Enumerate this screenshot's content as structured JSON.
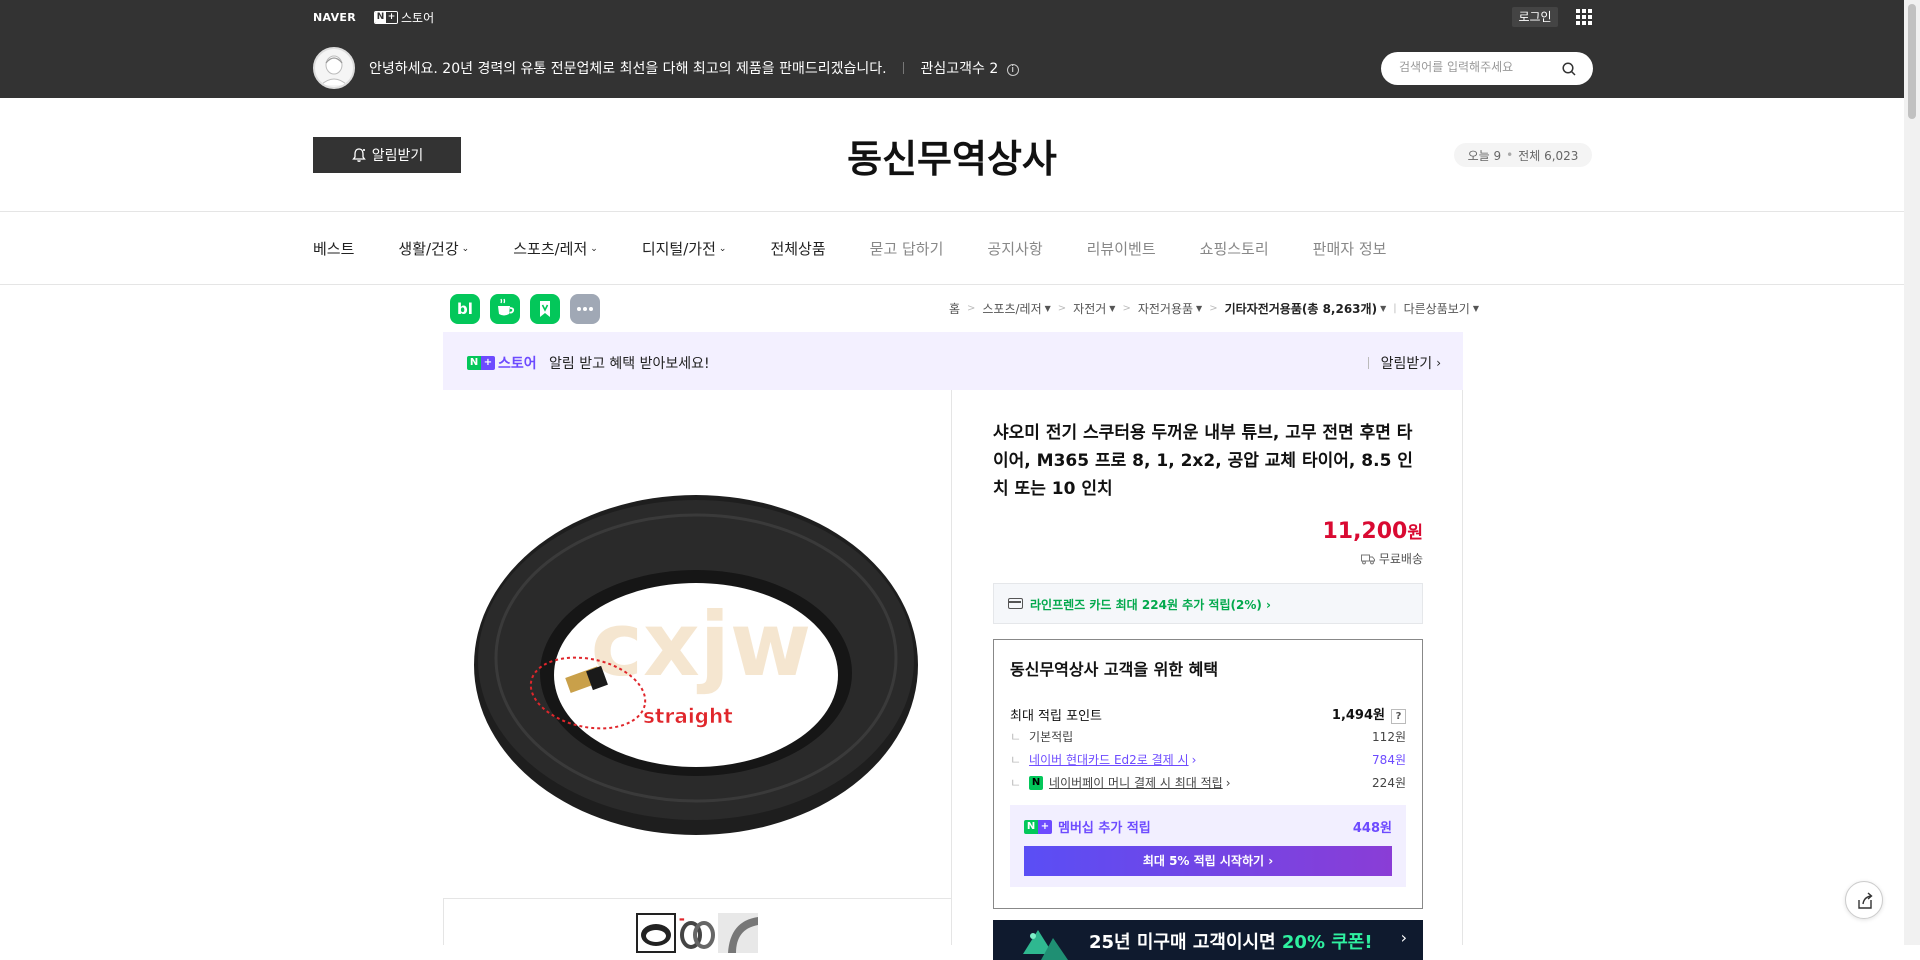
{
  "gnb": {
    "naver_logo": "NAVER",
    "nplus_n": "N",
    "nplus_plus": "+",
    "nplus_label": "스토어",
    "login": "로그인"
  },
  "seller": {
    "intro": "안녕하세요. 20년 경력의 유통 전문업체로 최선을 다해 최고의 제품을 판매드리겠습니다.",
    "followers": "관심고객수 2",
    "info_symbol": "i"
  },
  "search": {
    "placeholder": "검색어를 입력해주세요"
  },
  "store": {
    "alarm_button": "알림받기",
    "name": "동신무역상사",
    "today_label": "오늘 9",
    "total_label": "전체 6,023",
    "dot": "•"
  },
  "nav": {
    "items": [
      {
        "label": "베스트",
        "dropdown": false,
        "dim": false
      },
      {
        "label": "생활/건강",
        "dropdown": true,
        "dim": false
      },
      {
        "label": "스포츠/레저",
        "dropdown": true,
        "dim": false
      },
      {
        "label": "디지털/가전",
        "dropdown": true,
        "dim": false
      },
      {
        "label": "전체상품",
        "dropdown": false,
        "dim": false
      },
      {
        "label": "묻고 답하기",
        "dropdown": false,
        "dim": true
      },
      {
        "label": "공지사항",
        "dropdown": false,
        "dim": true
      },
      {
        "label": "리뷰이벤트",
        "dropdown": false,
        "dim": true
      },
      {
        "label": "쇼핑스토리",
        "dropdown": false,
        "dim": true
      },
      {
        "label": "판매자 정보",
        "dropdown": false,
        "dim": true
      }
    ]
  },
  "share": {
    "blog": "bl",
    "colors": {
      "blog": "#03c75a",
      "cafe": "#03c75a",
      "bookmark": "#03c75a",
      "more": "#a0a8b5"
    }
  },
  "breadcrumb": {
    "home": "홈",
    "c1": "스포츠/레저",
    "c2": "자전거",
    "c3": "자전거용품",
    "c4": "기타자전거용품(총 8,263개)",
    "other": "다른상품보기"
  },
  "promo": {
    "logo_n": "N",
    "logo_plus": "+",
    "logo_text": "스토어",
    "text": "알림 받고 혜택 받아보세요!",
    "right_label": "알림받기"
  },
  "product": {
    "image_watermark": "cxjw",
    "image_label": "straight",
    "title": "샤오미 전기 스쿠터용 두꺼운 내부 튜브, 고무 전면 후면 타이어, M365 프로 8, 1, 2x2, 공압 교체 타이어, 8.5 인치 또는 10 인치",
    "price": "11,200",
    "price_unit": "원",
    "shipping": "무료배송",
    "card_promo": "라인프렌즈 카드 최대 224원 추가 적립(2%)",
    "price_color": "#d90a32"
  },
  "benefit": {
    "title": "동신무역상사 고객을 위한 혜택",
    "max_point_label": "최대 적립 포인트",
    "max_point_value": "1,494원",
    "qmark": "?",
    "tree": "ㄴ",
    "npay_mark": "N",
    "rows": [
      {
        "label": "기본적립",
        "value": "112원"
      },
      {
        "label": "네이버 현대카드 Ed2로 결제 시",
        "value": "784원"
      },
      {
        "label": "네이버페이 머니 결제 시 최대 적립",
        "value": "224원"
      }
    ],
    "member": {
      "label": "멤버십 추가 적립",
      "value": "448원",
      "button": "최대 5% 적립 시작하기",
      "logo_n": "N",
      "logo_plus": "+"
    }
  },
  "banner": {
    "text": "25년 미구매 고객이시면 ",
    "highlight": "20% 쿠폰!"
  },
  "colors": {
    "accent": "#6d4bff",
    "naver_green": "#03c75a",
    "header_bg": "#333333"
  }
}
